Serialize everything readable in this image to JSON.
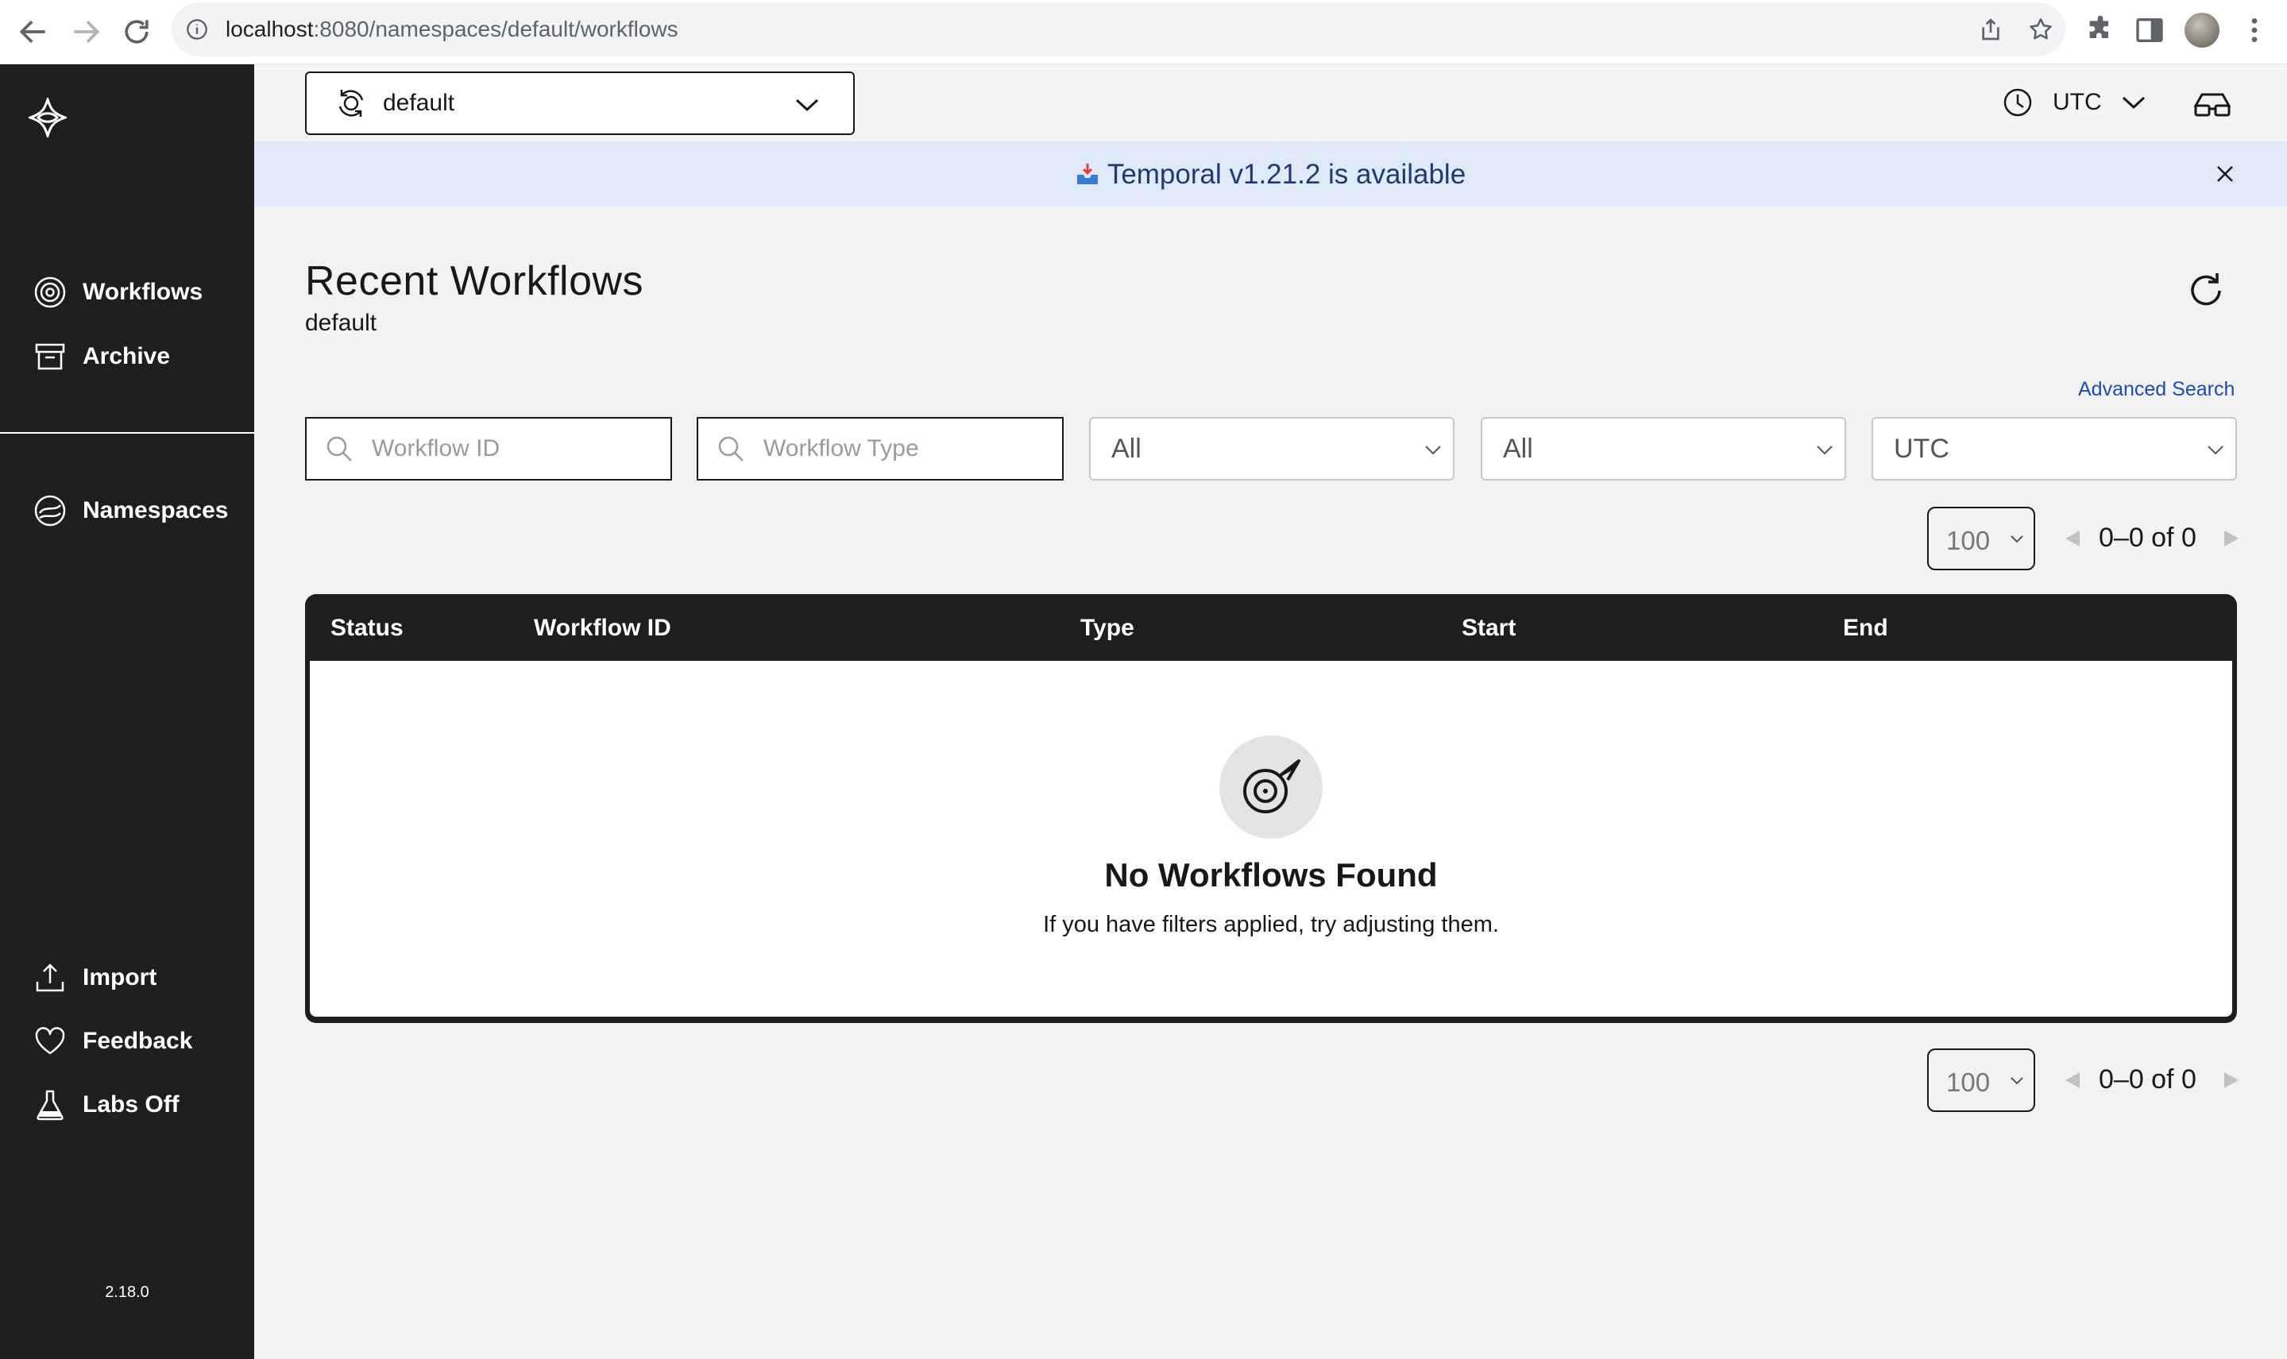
{
  "browser": {
    "url_host": "localhost",
    "url_path": ":8080/namespaces/default/workflows"
  },
  "sidebar": {
    "items": [
      {
        "label": "Workflows",
        "icon": "workflows-icon"
      },
      {
        "label": "Archive",
        "icon": "archive-icon"
      },
      {
        "label": "Namespaces",
        "icon": "namespaces-icon"
      }
    ],
    "bottom_items": [
      {
        "label": "Import",
        "icon": "upload-icon"
      },
      {
        "label": "Feedback",
        "icon": "heart-icon"
      },
      {
        "label": "Labs Off",
        "icon": "flask-icon"
      }
    ],
    "version": "2.18.0"
  },
  "topbar": {
    "namespace": "default",
    "timezone": "UTC"
  },
  "banner": {
    "text": "Temporal v1.21.2 is available"
  },
  "page": {
    "title": "Recent Workflows",
    "subtitle": "default",
    "advanced_search": "Advanced Search"
  },
  "filters": {
    "workflow_id_placeholder": "Workflow ID",
    "workflow_type_placeholder": "Workflow Type",
    "status_value": "All",
    "time_range_value": "All",
    "timezone_value": "UTC"
  },
  "pagination": {
    "page_size": "100",
    "range": "0–0 of 0"
  },
  "table": {
    "columns": [
      "Status",
      "Workflow ID",
      "Type",
      "Start",
      "End"
    ],
    "rows": [],
    "empty_title": "No Workflows Found",
    "empty_subtitle": "If you have filters applied, try adjusting them."
  },
  "colors": {
    "sidebar_bg": "#1e1e1e",
    "banner_bg": "#dfe9f7",
    "banner_text": "#1f3a72",
    "link": "#1d4bb5",
    "page_bg": "#f2f2f2"
  }
}
